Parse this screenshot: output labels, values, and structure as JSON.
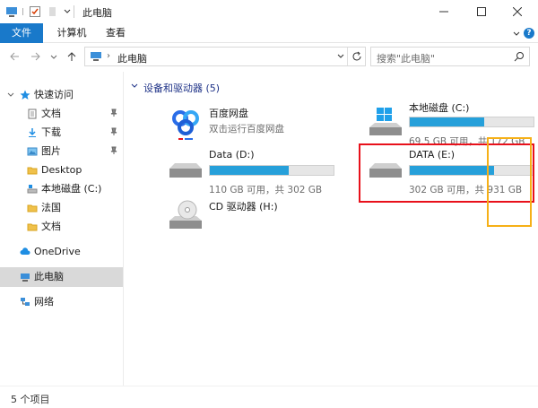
{
  "window": {
    "title": "此电脑"
  },
  "ribbon": {
    "tabs": [
      "文件",
      "计算机",
      "查看"
    ],
    "help": "?"
  },
  "address": {
    "chevron": "›",
    "path": "此电脑",
    "search_placeholder": "搜索\"此电脑\""
  },
  "nav": {
    "quick_access": "快速访问",
    "items": [
      "文档",
      "下载",
      "图片",
      "Desktop",
      "本地磁盘 (C:)",
      "法国",
      "文档"
    ],
    "onedrive": "OneDrive",
    "this_pc": "此电脑",
    "network": "网络"
  },
  "content": {
    "group_header": "设备和驱动器 (5)",
    "tiles": [
      {
        "name": "百度网盘",
        "sub": "双击运行百度网盘"
      },
      {
        "name": "本地磁盘 (C:)",
        "sub": "69.5 GB 可用，共 172 GB",
        "used_fraction": 0.6
      },
      {
        "name": "Data (D:)",
        "sub": "110 GB 可用，共 302 GB",
        "used_fraction": 0.64
      },
      {
        "name": "DATA (E:)",
        "sub": "302 GB 可用，共 931 GB",
        "used_fraction": 0.68
      },
      {
        "name": "CD 驱动器 (H:)"
      }
    ]
  },
  "status": {
    "count": "5 个项目"
  },
  "colors": {
    "accent": "#1979ca",
    "bar": "#26a0da",
    "highlight_red": "#e8111b",
    "highlight_yellow": "#f6b017"
  }
}
